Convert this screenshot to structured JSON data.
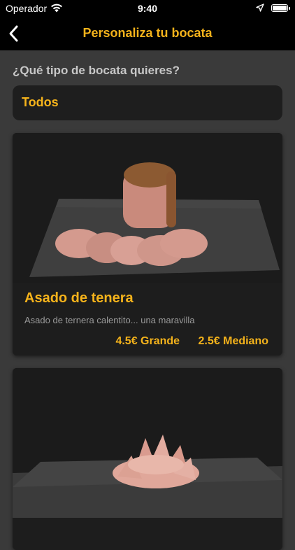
{
  "status_bar": {
    "carrier": "Operador",
    "time": "9:40"
  },
  "nav": {
    "title": "Personaliza tu bocata"
  },
  "question": "¿Qué tipo de bocata quieres?",
  "filter": {
    "selected": "Todos"
  },
  "products": [
    {
      "name": "Asado de tenera",
      "description": "Asado de ternera calentito... una maravilla",
      "price_large": "4.5€",
      "size_large": "Grande",
      "price_medium": "2.5€",
      "size_medium": "Mediano"
    },
    {
      "name": "",
      "description": ""
    }
  ],
  "colors": {
    "accent": "#f5b31b",
    "background": "#3a3a3a",
    "card": "#1d1d1d",
    "bar": "#000000"
  },
  "icons": {
    "back": "chevron-left-icon",
    "wifi": "wifi-icon",
    "location": "location-arrow-icon",
    "battery": "battery-icon"
  }
}
